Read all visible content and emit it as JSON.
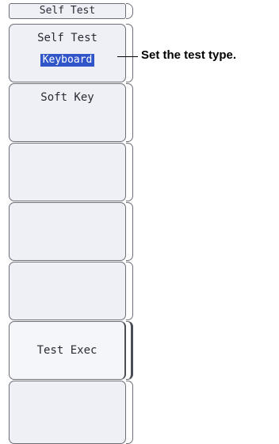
{
  "menu": {
    "title": "Self Test",
    "keys": [
      {
        "label": "Self Test",
        "value": "Keyboard"
      },
      {
        "label": "Soft Key"
      },
      {
        "label": ""
      },
      {
        "label": ""
      },
      {
        "label": ""
      },
      {
        "label": "Test Exec"
      },
      {
        "label": ""
      }
    ]
  },
  "annotation": {
    "text": "Set the test type."
  }
}
